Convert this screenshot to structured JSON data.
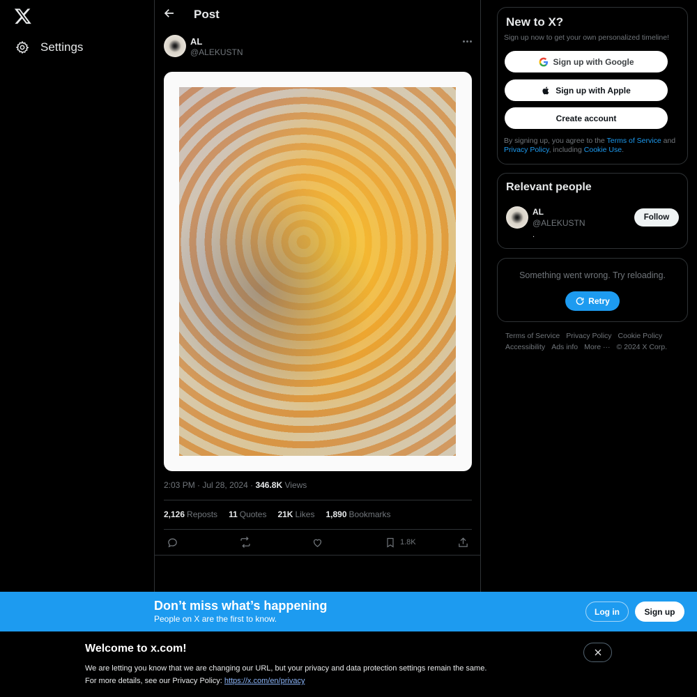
{
  "nav": {
    "settings_label": "Settings"
  },
  "post": {
    "header_title": "Post",
    "author_name": "AL",
    "author_handle": "@ALEKUSTN",
    "time": "2:03 PM",
    "date": "Jul 28, 2024",
    "views_count": "346.8K",
    "views_label": "Views",
    "stats": [
      {
        "count": "2,126",
        "label": "Reposts"
      },
      {
        "count": "11",
        "label": "Quotes"
      },
      {
        "count": "21K",
        "label": "Likes"
      },
      {
        "count": "1,890",
        "label": "Bookmarks"
      }
    ],
    "bookmark_count": "1.8K"
  },
  "signup_card": {
    "title": "New to X?",
    "subtitle": "Sign up now to get your own personalized timeline!",
    "google_label": "Sign up with Google",
    "apple_label": "Sign up with Apple",
    "create_label": "Create account",
    "legal_prefix": "By signing up, you agree to the",
    "terms_link": "Terms of Service",
    "legal_and": "and",
    "privacy_link": "Privacy Policy",
    "legal_including": ", including",
    "cookie_link": "Cookie Use",
    "legal_end": "."
  },
  "relevant_people": {
    "title": "Relevant people",
    "name": "AL",
    "handle": "@ALEKUSTN",
    "bio": ".",
    "follow_label": "Follow"
  },
  "error_card": {
    "message": "Something went wrong. Try reloading.",
    "retry_label": "Retry"
  },
  "footer": {
    "links": [
      "Terms of Service",
      "Privacy Policy",
      "Cookie Policy",
      "Accessibility",
      "Ads info",
      "More ···"
    ],
    "copyright": "© 2024 X Corp."
  },
  "banner": {
    "title": "Don’t miss what’s happening",
    "subtitle": "People on X are the first to know.",
    "login_label": "Log in",
    "signup_label": "Sign up"
  },
  "welcome": {
    "title": "Welcome to x.com!",
    "line1": "We are letting you know that we are changing our URL, but your privacy and data protection settings remain the same.",
    "line2_prefix": "For more details, see our Privacy Policy: ",
    "link": "https://x.com/en/privacy"
  },
  "colors": {
    "accent": "#1d9bf0",
    "background": "#000000",
    "border": "#2f3336",
    "muted": "#71767b"
  },
  "icons": [
    "x-logo-icon",
    "gear-icon",
    "back-arrow-icon",
    "more-dots-icon",
    "google-icon",
    "apple-icon",
    "retry-icon",
    "reply-icon",
    "repost-icon",
    "like-icon",
    "bookmark-icon",
    "share-icon",
    "close-icon"
  ]
}
